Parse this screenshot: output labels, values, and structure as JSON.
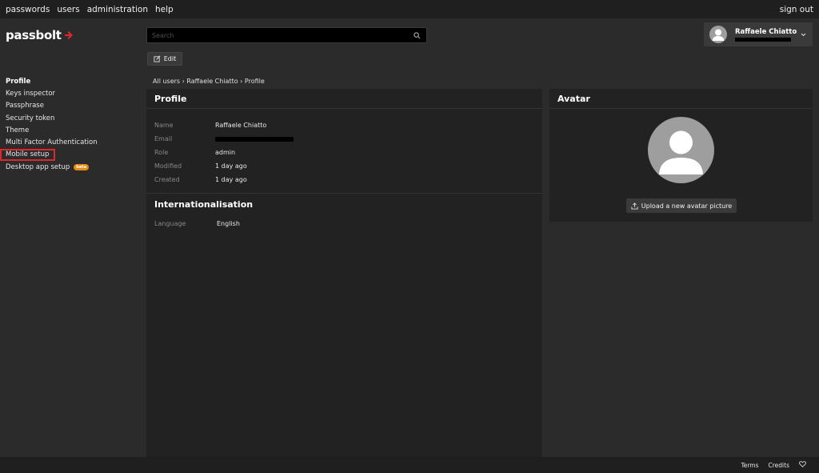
{
  "topnav": {
    "links": [
      "passwords",
      "users",
      "administration",
      "help"
    ],
    "signout": "sign out"
  },
  "brand": {
    "name": "passbolt",
    "accent": "#e0262a"
  },
  "search": {
    "placeholder": "Search",
    "icon": "search-icon"
  },
  "toolbar": {
    "edit_label": "Edit",
    "edit_icon": "edit-icon"
  },
  "user": {
    "name": "Raffaele Chiatto",
    "email_masked": true
  },
  "sidebar": {
    "items": [
      {
        "label": "Profile",
        "active": true
      },
      {
        "label": "Keys inspector"
      },
      {
        "label": "Passphrase"
      },
      {
        "label": "Security token"
      },
      {
        "label": "Theme"
      },
      {
        "label": "Multi Factor Authentication"
      },
      {
        "label": "Mobile setup",
        "highlighted": true
      },
      {
        "label": "Desktop app setup",
        "badge": "beta"
      }
    ],
    "badge_color": "#e58a15"
  },
  "breadcrumb": "All users › Raffaele Chiatto › Profile",
  "profile": {
    "title": "Profile",
    "fields": [
      {
        "label": "Name",
        "value": "Raffaele Chiatto"
      },
      {
        "label": "Email",
        "value": ""
      },
      {
        "label": "Role",
        "value": "admin"
      },
      {
        "label": "Modified",
        "value": "1 day ago"
      },
      {
        "label": "Created",
        "value": "1 day ago"
      }
    ]
  },
  "internationalisation": {
    "title": "Internationalisation",
    "language_label": "Language",
    "language_value": "English"
  },
  "avatar_panel": {
    "title": "Avatar",
    "upload_label": "Upload a new avatar picture",
    "upload_icon": "upload-icon"
  },
  "footer": {
    "terms": "Terms",
    "credits": "Credits",
    "heart_icon": "heart-icon"
  }
}
